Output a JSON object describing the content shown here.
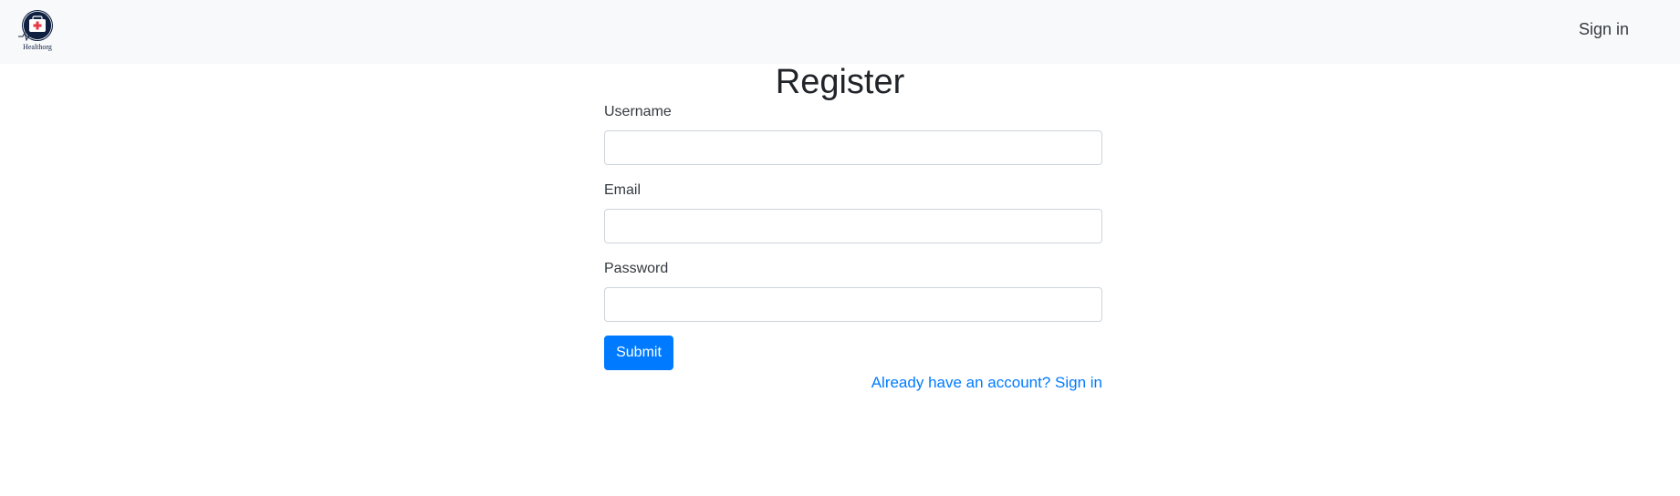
{
  "navbar": {
    "logo_icon": "medical-kit-logo-icon",
    "logo_text": "Healthorg",
    "signin_label": "Sign in",
    "background": "#f8f9fa"
  },
  "page": {
    "title": "Register"
  },
  "form": {
    "username_label": "Username",
    "username_value": "",
    "email_label": "Email",
    "email_value": "",
    "password_label": "Password",
    "password_value": "",
    "submit_label": "Submit",
    "alt_link": "Already have an account? Sign in"
  },
  "colors": {
    "primary": "#007bff",
    "logo_navy": "#0f2041",
    "logo_red": "#e63946"
  }
}
